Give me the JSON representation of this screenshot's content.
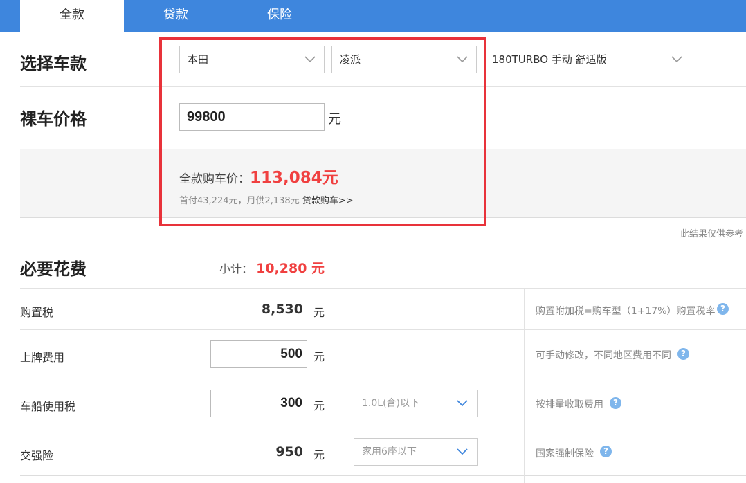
{
  "tabs": [
    {
      "label": "全款",
      "active": true
    },
    {
      "label": "贷款",
      "active": false
    },
    {
      "label": "保险",
      "active": false
    }
  ],
  "select_car": {
    "title": "选择车款",
    "brand": "本田",
    "model": "凌派",
    "trim": "180TURBO 手动 舒适版"
  },
  "bare_price": {
    "title": "裸车价格",
    "value": "99800",
    "unit": "元"
  },
  "result": {
    "label": "全款购车价：",
    "value": "113,084元",
    "sub_text": "首付43,224元，月供2,138元",
    "loan_link": "贷款购车>>",
    "disclaimer": "此结果仅供参考"
  },
  "required": {
    "title": "必要花费",
    "subtotal_label": "小计：",
    "subtotal_value": "10,280 元",
    "rows": [
      {
        "label": "购置税",
        "value": "8,530",
        "unit": "元",
        "note": "购置附加税=购车型（1+17%）购置税率"
      },
      {
        "label": "上牌费用",
        "value": "500",
        "unit": "元",
        "note": "可手动修改，不同地区费用不同"
      },
      {
        "label": "车船使用税",
        "value": "300",
        "unit": "元",
        "option": "1.0L(含)以下",
        "note": "按排量收取费用"
      },
      {
        "label": "交强险",
        "value": "950",
        "unit": "元",
        "option": "家用6座以下",
        "note": "国家强制保险"
      }
    ]
  },
  "colors": {
    "tab_bg": "#3e86dd",
    "accent_red": "#f04040",
    "highlight_border": "#e8323a",
    "help_icon": "#7fb6ec"
  },
  "icons": {
    "dropdown": "chevron-down-icon",
    "help": "question-circle-icon"
  }
}
